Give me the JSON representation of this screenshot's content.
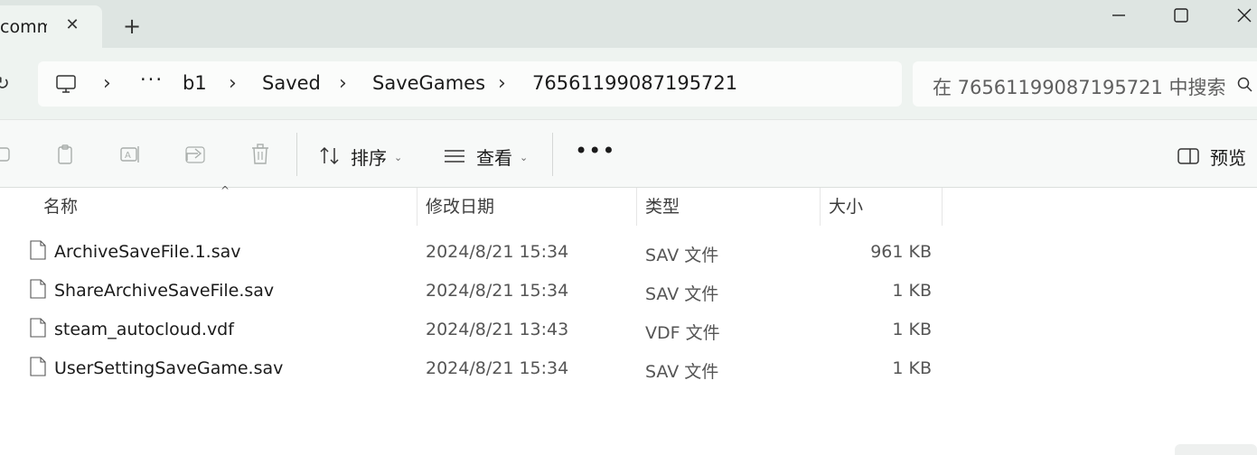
{
  "tab": {
    "title": "comm"
  },
  "address": {
    "crumbs": [
      "b1",
      "Saved",
      "SaveGames",
      "76561199087195721"
    ]
  },
  "search": {
    "placeholder": "在 76561199087195721 中搜索"
  },
  "toolbar": {
    "sort_label": "排序",
    "view_label": "查看",
    "preview_label": "预览"
  },
  "columns": {
    "name": "名称",
    "date": "修改日期",
    "type": "类型",
    "size": "大小"
  },
  "files": [
    {
      "name": "ArchiveSaveFile.1.sav",
      "date": "2024/8/21 15:34",
      "type": "SAV 文件",
      "size": "961 KB"
    },
    {
      "name": "ShareArchiveSaveFile.sav",
      "date": "2024/8/21 15:34",
      "type": "SAV 文件",
      "size": "1 KB"
    },
    {
      "name": "steam_autocloud.vdf",
      "date": "2024/8/21 13:43",
      "type": "VDF 文件",
      "size": "1 KB"
    },
    {
      "name": "UserSettingSaveGame.sav",
      "date": "2024/8/21 15:34",
      "type": "SAV 文件",
      "size": "1 KB"
    }
  ]
}
